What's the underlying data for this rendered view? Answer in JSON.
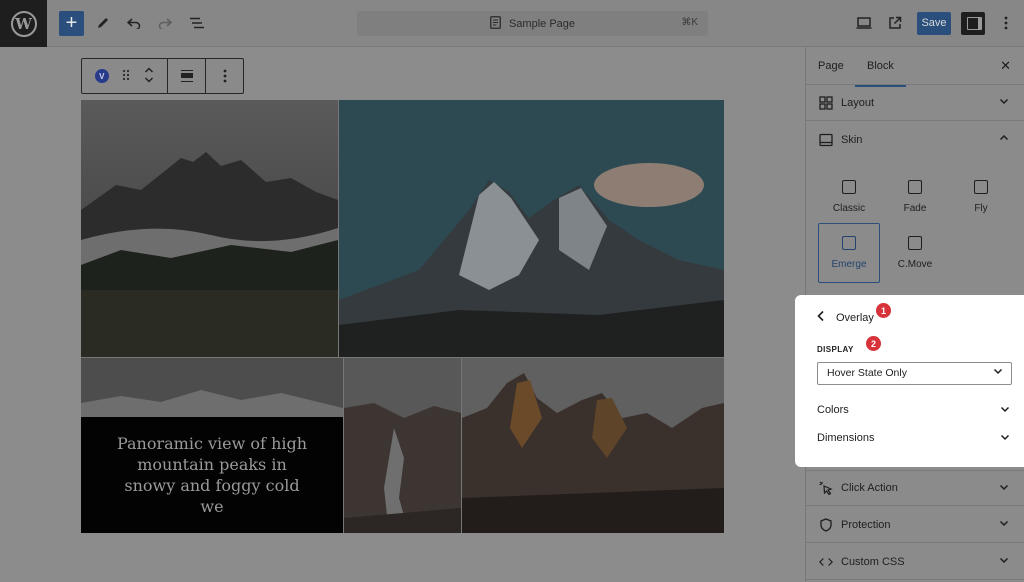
{
  "topbar": {
    "logo_letter": "W",
    "add_label": "+",
    "document_title": "Sample Page",
    "shortcut": "⌘K",
    "save_label": "Save"
  },
  "block_toolbar": {
    "block_badge": "V"
  },
  "gallery": {
    "caption": "Panoramic view of high mountain peaks in snowy and foggy cold we"
  },
  "panel": {
    "tabs": [
      {
        "label": "Page"
      },
      {
        "label": "Block"
      }
    ],
    "close": "✕",
    "layout_label": "Layout",
    "skin_label": "Skin",
    "skins": [
      {
        "label": "Classic"
      },
      {
        "label": "Fade"
      },
      {
        "label": "Fly"
      },
      {
        "label": "Emerge"
      },
      {
        "label": "C.Move"
      }
    ],
    "selected_skin": "Emerge",
    "click_action_label": "Click Action",
    "protection_label": "Protection",
    "custom_css_label": "Custom CSS"
  },
  "overlay": {
    "title": "Overlay",
    "badge_1": "1",
    "display_label": "DISPLAY",
    "badge_2": "2",
    "display_value": "Hover State Only",
    "colors_label": "Colors",
    "dimensions_label": "Dimensions"
  },
  "colors": {
    "accent": "#2a4f7d",
    "badge_red": "#d8323a"
  }
}
